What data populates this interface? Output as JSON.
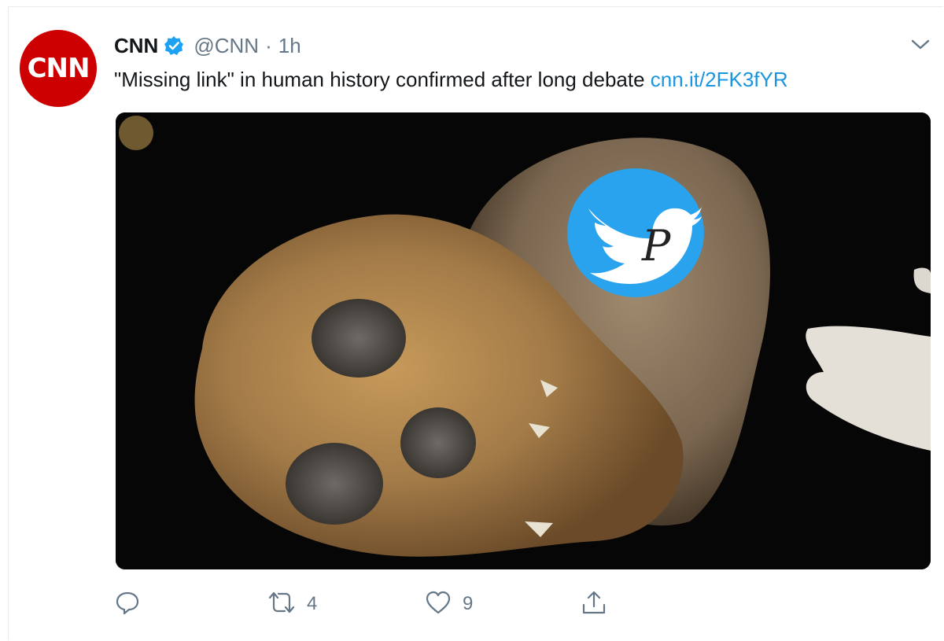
{
  "tweet": {
    "author_name": "CNN",
    "avatar_logo": "CNN",
    "handle": "@CNN",
    "separator": "·",
    "time": "1h",
    "text": "\"Missing link\" in human history confirmed after long debate ",
    "link": "cnn.it/2FK3fYR",
    "watermark_letter": "P"
  },
  "actions": {
    "reply_count": "",
    "retweet_count": "4",
    "like_count": "9"
  },
  "icons": {
    "verified": "verified-badge-icon",
    "caret": "chevron-down-icon",
    "reply": "reply-icon",
    "retweet": "retweet-icon",
    "like": "heart-icon",
    "share": "share-icon"
  },
  "colors": {
    "brand_red": "#cc0000",
    "link_blue": "#1b95e0",
    "muted": "#657786"
  }
}
